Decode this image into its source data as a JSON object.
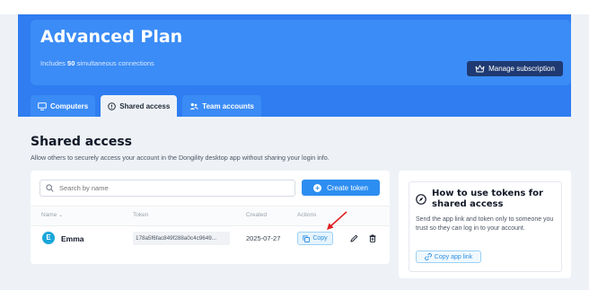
{
  "plan": {
    "title": "Advanced Plan",
    "subtitle_prefix": "Includes",
    "connections": "50",
    "subtitle_suffix": "simultaneous connections",
    "manage_label": "Manage subscription"
  },
  "tabs": [
    {
      "label": "Computers",
      "icon": "monitor-icon",
      "active": false
    },
    {
      "label": "Shared access",
      "icon": "info-circle-icon",
      "active": true
    },
    {
      "label": "Team accounts",
      "icon": "people-icon",
      "active": false
    }
  ],
  "section": {
    "title": "Shared access",
    "description": "Allow others to securely access your account in the Dongility desktop app without sharing your login info."
  },
  "search": {
    "placeholder": "Search by name"
  },
  "create_token_label": "Create token",
  "table": {
    "columns": [
      "Name",
      "Token",
      "Created",
      "Actions"
    ],
    "rows": [
      {
        "avatar": "E",
        "name": "Emma",
        "token": "178a5f6fac849f288a0c4c9649...",
        "created": "2025-07-27",
        "copy_label": "Copy"
      }
    ]
  },
  "help": {
    "title": "How to use tokens for shared access",
    "text": "Send the app link and token only to someone you trust so they can log in to your account.",
    "copy_link_label": "Copy app link"
  },
  "colors": {
    "brand_blue": "#2f7df0",
    "dark_button": "#1f3a72",
    "accent": "#2d8ef1",
    "annotation_red": "#e02020"
  }
}
